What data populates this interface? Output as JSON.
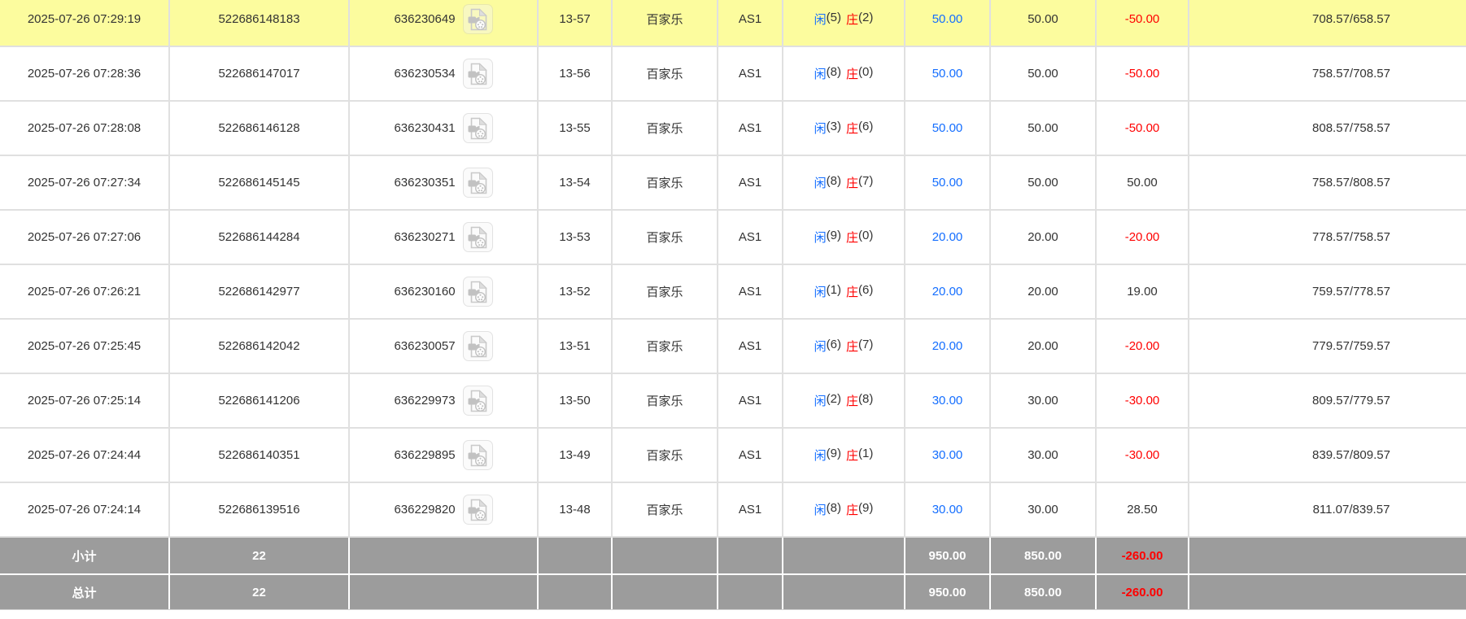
{
  "colors": {
    "highlight_row_bg": "#fcfc9e",
    "accent_blue": "#146eff",
    "accent_red": "#ff0000",
    "summary_bg": "#9c9c9c",
    "text": "#333333",
    "border": "#e0e0e0"
  },
  "icons": {
    "replay": "video-replay-icon"
  },
  "table": {
    "rows": [
      {
        "time": "2025-07-26 07:29:19",
        "bet_id": "522686148183",
        "game_id": "636230649",
        "round": "13-57",
        "game": "百家乐",
        "table": "AS1",
        "player": "闲",
        "player_n": "(5)",
        "banker": "庄",
        "banker_n": "(2)",
        "bet": "50.00",
        "valid": "50.00",
        "win_loss": "-50.00",
        "balance": "708.57/658.57",
        "highlighted": true
      },
      {
        "time": "2025-07-26 07:28:36",
        "bet_id": "522686147017",
        "game_id": "636230534",
        "round": "13-56",
        "game": "百家乐",
        "table": "AS1",
        "player": "闲",
        "player_n": "(8)",
        "banker": "庄",
        "banker_n": "(0)",
        "bet": "50.00",
        "valid": "50.00",
        "win_loss": "-50.00",
        "balance": "758.57/708.57",
        "highlighted": false
      },
      {
        "time": "2025-07-26 07:28:08",
        "bet_id": "522686146128",
        "game_id": "636230431",
        "round": "13-55",
        "game": "百家乐",
        "table": "AS1",
        "player": "闲",
        "player_n": "(3)",
        "banker": "庄",
        "banker_n": "(6)",
        "bet": "50.00",
        "valid": "50.00",
        "win_loss": "-50.00",
        "balance": "808.57/758.57",
        "highlighted": false
      },
      {
        "time": "2025-07-26 07:27:34",
        "bet_id": "522686145145",
        "game_id": "636230351",
        "round": "13-54",
        "game": "百家乐",
        "table": "AS1",
        "player": "闲",
        "player_n": "(8)",
        "banker": "庄",
        "banker_n": "(7)",
        "bet": "50.00",
        "valid": "50.00",
        "win_loss": "50.00",
        "balance": "758.57/808.57",
        "highlighted": false
      },
      {
        "time": "2025-07-26 07:27:06",
        "bet_id": "522686144284",
        "game_id": "636230271",
        "round": "13-53",
        "game": "百家乐",
        "table": "AS1",
        "player": "闲",
        "player_n": "(9)",
        "banker": "庄",
        "banker_n": "(0)",
        "bet": "20.00",
        "valid": "20.00",
        "win_loss": "-20.00",
        "balance": "778.57/758.57",
        "highlighted": false
      },
      {
        "time": "2025-07-26 07:26:21",
        "bet_id": "522686142977",
        "game_id": "636230160",
        "round": "13-52",
        "game": "百家乐",
        "table": "AS1",
        "player": "闲",
        "player_n": "(1)",
        "banker": "庄",
        "banker_n": "(6)",
        "bet": "20.00",
        "valid": "20.00",
        "win_loss": "19.00",
        "balance": "759.57/778.57",
        "highlighted": false
      },
      {
        "time": "2025-07-26 07:25:45",
        "bet_id": "522686142042",
        "game_id": "636230057",
        "round": "13-51",
        "game": "百家乐",
        "table": "AS1",
        "player": "闲",
        "player_n": "(6)",
        "banker": "庄",
        "banker_n": "(7)",
        "bet": "20.00",
        "valid": "20.00",
        "win_loss": "-20.00",
        "balance": "779.57/759.57",
        "highlighted": false
      },
      {
        "time": "2025-07-26 07:25:14",
        "bet_id": "522686141206",
        "game_id": "636229973",
        "round": "13-50",
        "game": "百家乐",
        "table": "AS1",
        "player": "闲",
        "player_n": "(2)",
        "banker": "庄",
        "banker_n": "(8)",
        "bet": "30.00",
        "valid": "30.00",
        "win_loss": "-30.00",
        "balance": "809.57/779.57",
        "highlighted": false
      },
      {
        "time": "2025-07-26 07:24:44",
        "bet_id": "522686140351",
        "game_id": "636229895",
        "round": "13-49",
        "game": "百家乐",
        "table": "AS1",
        "player": "闲",
        "player_n": "(9)",
        "banker": "庄",
        "banker_n": "(1)",
        "bet": "30.00",
        "valid": "30.00",
        "win_loss": "-30.00",
        "balance": "839.57/809.57",
        "highlighted": false
      },
      {
        "time": "2025-07-26 07:24:14",
        "bet_id": "522686139516",
        "game_id": "636229820",
        "round": "13-48",
        "game": "百家乐",
        "table": "AS1",
        "player": "闲",
        "player_n": "(8)",
        "banker": "庄",
        "banker_n": "(9)",
        "bet": "30.00",
        "valid": "30.00",
        "win_loss": "28.50",
        "balance": "811.07/839.57",
        "highlighted": false
      }
    ],
    "subtotal": {
      "label": "小计",
      "count": "22",
      "bet": "950.00",
      "valid": "850.00",
      "win_loss": "-260.00"
    },
    "total": {
      "label": "总计",
      "count": "22",
      "bet": "950.00",
      "valid": "850.00",
      "win_loss": "-260.00"
    }
  }
}
